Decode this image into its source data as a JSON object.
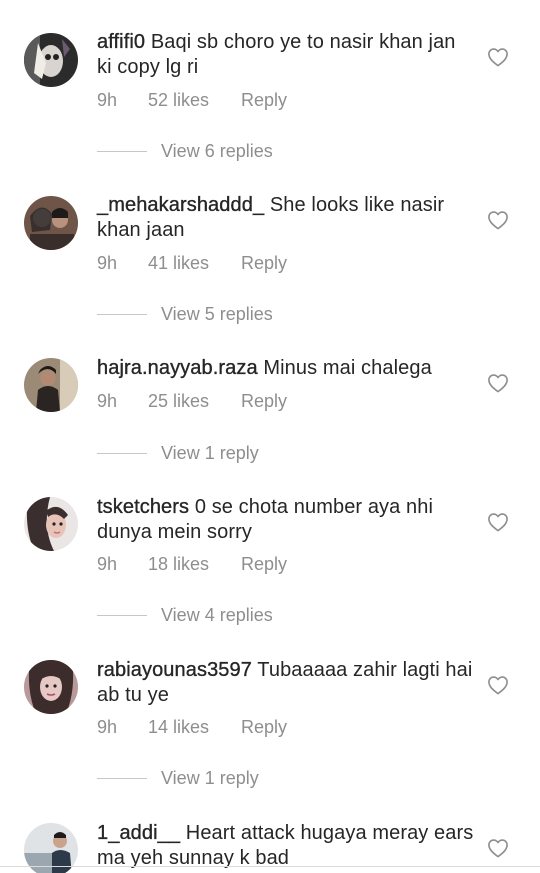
{
  "comments": [
    {
      "username": "affifi0",
      "text": "Baqi sb choro ye to nasir khan jan ki copy lg ri",
      "time": "9h",
      "likes": "52 likes",
      "reply_label": "Reply",
      "view_replies": "View 6 replies",
      "avatar_icon": "avatar-photo",
      "avatar_colors": [
        "#3a3a3a",
        "#d9d4cf",
        "#6b5a70"
      ]
    },
    {
      "username": "_mehakarshaddd_",
      "text": "She looks like nasir khan jaan",
      "time": "9h",
      "likes": "41 likes",
      "reply_label": "Reply",
      "view_replies": "View 5 replies",
      "avatar_icon": "avatar-photo",
      "avatar_colors": [
        "#7a5a4a",
        "#c9a89a",
        "#2e2a2a"
      ]
    },
    {
      "username": "hajra.nayyab.raza",
      "text": "Minus mai chalega",
      "time": "9h",
      "likes": "25 likes",
      "reply_label": "Reply",
      "view_replies": "View 1 reply",
      "avatar_icon": "avatar-photo",
      "avatar_colors": [
        "#8a7a6a",
        "#d8cbb8",
        "#2a2422"
      ]
    },
    {
      "username": "tsketchers",
      "text": "0 se chota number aya nhi dunya mein sorry",
      "time": "9h",
      "likes": "18 likes",
      "reply_label": "Reply",
      "view_replies": "View 4 replies",
      "avatar_icon": "avatar-photo",
      "avatar_colors": [
        "#e8e2e2",
        "#c89a90",
        "#3a2e2e"
      ]
    },
    {
      "username": "rabiayounas3597",
      "text": "Tubaaaaa zahir lagti hai ab tu ye",
      "time": "9h",
      "likes": "14 likes",
      "reply_label": "Reply",
      "view_replies": "View 1 reply",
      "avatar_icon": "avatar-photo",
      "avatar_colors": [
        "#b89a9a",
        "#e6c8c4",
        "#3c2c2c"
      ]
    },
    {
      "username": "1_addi__",
      "text": "Heart attack hugaya meray ears ma yeh sunnay k bad",
      "time": "",
      "likes": "",
      "reply_label": "",
      "view_replies": "",
      "avatar_icon": "avatar-photo",
      "avatar_colors": [
        "#dfe3e6",
        "#2c3a4a",
        "#9aa6b0"
      ]
    }
  ],
  "icons": {
    "like": "heart-outline-icon"
  },
  "colors": {
    "text": "#262626",
    "secondary": "#8e8e8e",
    "divider": "#c7c7c7"
  }
}
